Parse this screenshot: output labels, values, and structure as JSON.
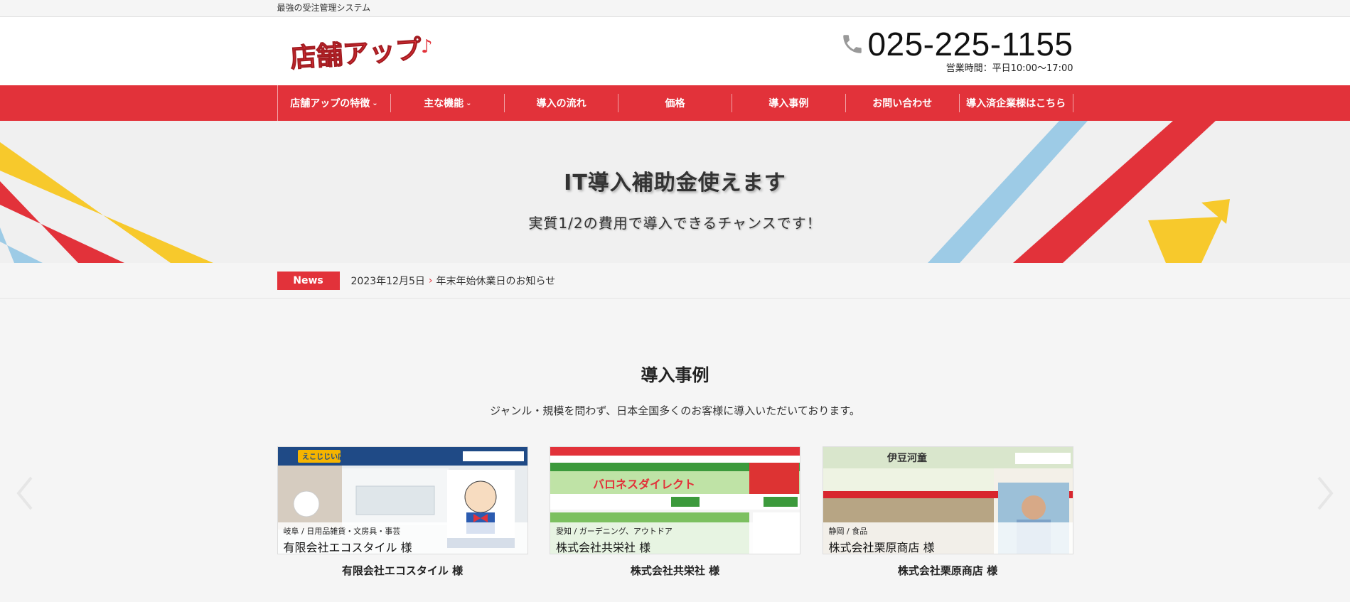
{
  "topbar": {
    "tagline": "最強の受注管理システム"
  },
  "header": {
    "logo_text": "店舗アップ♪",
    "phone": "025-225-1155",
    "hours": "営業時間：平日10:00〜17:00"
  },
  "nav": {
    "items": [
      {
        "label": "店舗アップの特徴",
        "dropdown": true
      },
      {
        "label": "主な機能",
        "dropdown": true
      },
      {
        "label": "導入の流れ",
        "dropdown": false
      },
      {
        "label": "価格",
        "dropdown": false
      },
      {
        "label": "導入事例",
        "dropdown": false
      },
      {
        "label": "お問い合わせ",
        "dropdown": false
      },
      {
        "label": "導入済企業様はこちら",
        "dropdown": false
      }
    ]
  },
  "hero": {
    "title": "IT導入補助金使えます",
    "subtitle": "実質1/2の費用で導入できるチャンスです！"
  },
  "news": {
    "badge": "News",
    "date": "2023年12月5日",
    "title": "年末年始休業日のお知らせ"
  },
  "cases": {
    "title": "導入事例",
    "lead": "ジャンル・規模を問わず、日本全国多くのお客様に導入いただいております。",
    "items": [
      {
        "tags": "岐阜 / 日用品雑貨・文房具・事芸",
        "caption": "有限会社エコスタイル 様",
        "name": "有限会社エコスタイル 様",
        "shop_label": "えこじじい店"
      },
      {
        "tags": "愛知 / ガーデニング、アウトドア",
        "caption": "株式会社共栄社 様",
        "name": "株式会社共栄社 様",
        "shop_label": "バロネスダイレクト"
      },
      {
        "tags": "静岡 / 食品",
        "caption": "株式会社栗原商店 様",
        "name": "株式会社栗原商店 様",
        "shop_label": "伊豆河童"
      }
    ]
  },
  "colors": {
    "brand_red": "#e2323a",
    "yellow": "#f7c92c",
    "sky": "#9dcbe6"
  }
}
